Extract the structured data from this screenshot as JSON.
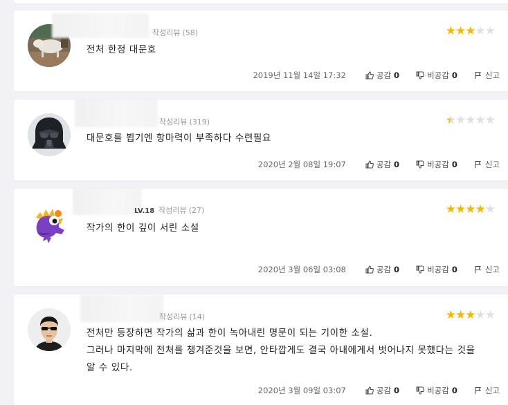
{
  "reviews": [
    {
      "review_count_label": "작성리뷰",
      "review_count": "(58)",
      "level": "",
      "rating": 3,
      "lines": [
        "전처 한정 대문호"
      ],
      "date": "2019년 11월 14일 17:32",
      "like_label": "공감",
      "like_count": "0",
      "dislike_label": "비공감",
      "dislike_count": "0",
      "report_label": "신고",
      "avatar_icon": "dog-photo-avatar"
    },
    {
      "review_count_label": "작성리뷰",
      "review_count": "(319)",
      "level": "",
      "rating": 0.5,
      "lines": [
        "대문호를 뵙기엔 항마력이 부족하다 수련필요"
      ],
      "date": "2020년 2월 08일 19:07",
      "like_label": "공감",
      "like_count": "0",
      "dislike_label": "비공감",
      "dislike_count": "0",
      "report_label": "신고",
      "avatar_icon": "darth-vader-avatar"
    },
    {
      "review_count_label": "작성리뷰",
      "review_count": "(27)",
      "level": "LV.18",
      "rating": 4,
      "lines": [
        "작가의 한이 깊이 서린 소설"
      ],
      "date": "2020년 3월 06일 03:08",
      "like_label": "공감",
      "like_count": "0",
      "dislike_label": "비공감",
      "dislike_count": "0",
      "report_label": "신고",
      "avatar_icon": "purple-dragon-avatar"
    },
    {
      "review_count_label": "작성리뷰",
      "review_count": "(14)",
      "level": "",
      "rating": 3,
      "lines": [
        "전처만 등장하면 작가의 삶과 한이 녹아내린 명문이 되는 기이한 소설.",
        "그러나 마지막에 전처를 챙겨준것을 보면, 안타깝게도 결국 아내에게서 벗어나지 못했다는 것을",
        "알 수 있다."
      ],
      "date": "2020년 3월 09일 03:07",
      "like_label": "공감",
      "like_count": "0",
      "dislike_label": "비공감",
      "dislike_count": "0",
      "report_label": "신고",
      "avatar_icon": "sunglasses-man-avatar"
    }
  ],
  "colors": {
    "star": "#f5b800",
    "star_empty": "#e0e0e0",
    "background": "#f2f2f6"
  }
}
